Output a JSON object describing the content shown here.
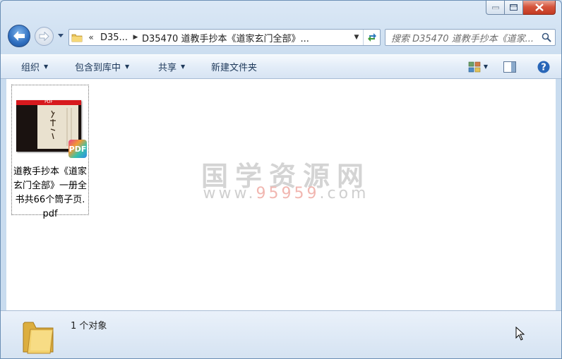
{
  "window": {
    "caption_buttons": [
      "minimize",
      "maximize",
      "close"
    ]
  },
  "nav": {
    "back_label": "Back",
    "forward_label": "Forward"
  },
  "address_bar": {
    "overflow_chevron": "«",
    "crumb_parent": "D35...",
    "crumb_current": "D35470 道教手抄本《道家玄门全部》..."
  },
  "search": {
    "placeholder": "搜索 D35470 道教手抄本《道家..."
  },
  "toolbar": {
    "organize": "组织",
    "include_in_library": "包含到库中",
    "share": "共享",
    "new_folder": "新建文件夹"
  },
  "files": [
    {
      "name": "道教手抄本《道家玄门全部》一册全书共66个筒子页.pdf",
      "thumb_bar_text": "PDF",
      "badge": "PDF"
    }
  ],
  "watermark": {
    "title": "国学资源网",
    "url_prefix": "www.",
    "url_number": "95959",
    "url_suffix": ".com"
  },
  "details": {
    "status": "1 个对象"
  },
  "colors": {
    "accent": "#2f6fc0",
    "close_red": "#c33a22",
    "watermark_gray": "#d4d4d4",
    "watermark_red": "#f1b6b0"
  }
}
